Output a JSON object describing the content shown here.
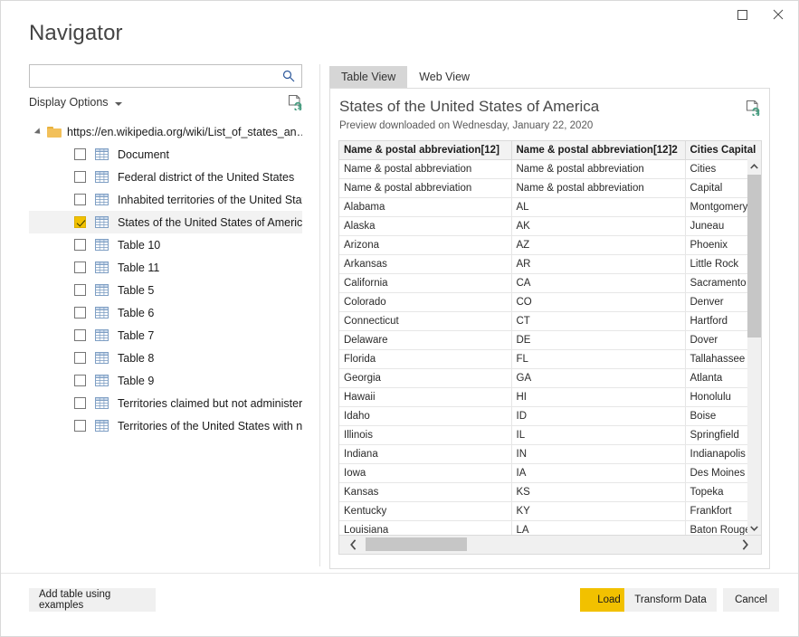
{
  "window": {
    "title": "Navigator",
    "controls": [
      {
        "name": "maximize",
        "glyph": "☐"
      },
      {
        "name": "close",
        "glyph": "✕"
      }
    ]
  },
  "left_pane": {
    "search": {
      "value": "",
      "placeholder": "",
      "icon": "search-icon"
    },
    "display_options": {
      "label": "Display Options",
      "caret": "chevron-down-icon"
    },
    "refresh_icon": "refresh-page-icon",
    "tree": {
      "root": {
        "label": "https://en.wikipedia.org/wiki/List_of_states_an…",
        "expanded": true,
        "icon": "folder-icon"
      },
      "items": [
        {
          "label": "Document",
          "checked": false,
          "selected": false
        },
        {
          "label": "Federal district of the United States",
          "checked": false,
          "selected": false
        },
        {
          "label": "Inhabited territories of the United States",
          "checked": false,
          "selected": false
        },
        {
          "label": "States of the United States of America",
          "checked": true,
          "selected": true
        },
        {
          "label": "Table 10",
          "checked": false,
          "selected": false
        },
        {
          "label": "Table 11",
          "checked": false,
          "selected": false
        },
        {
          "label": "Table 5",
          "checked": false,
          "selected": false
        },
        {
          "label": "Table 6",
          "checked": false,
          "selected": false
        },
        {
          "label": "Table 7",
          "checked": false,
          "selected": false
        },
        {
          "label": "Table 8",
          "checked": false,
          "selected": false
        },
        {
          "label": "Table 9",
          "checked": false,
          "selected": false
        },
        {
          "label": "Territories claimed but not administered b…",
          "checked": false,
          "selected": false
        },
        {
          "label": "Territories of the United States with no in…",
          "checked": false,
          "selected": false
        }
      ]
    }
  },
  "right_pane": {
    "tabs": [
      {
        "label": "Table View",
        "active": true
      },
      {
        "label": "Web View",
        "active": false
      }
    ],
    "preview": {
      "title": "States of the United States of America",
      "subtitle": "Preview downloaded on Wednesday, January 22, 2020",
      "refresh_icon": "refresh-page-icon"
    },
    "grid": {
      "columns": [
        "Name & postal abbreviation[12]",
        "Name & postal abbreviation[12]2",
        "Cities Capital"
      ],
      "rows": [
        [
          "Name & postal abbreviation",
          "Name & postal abbreviation",
          "Cities"
        ],
        [
          "Name & postal abbreviation",
          "Name & postal abbreviation",
          "Capital"
        ],
        [
          "Alabama",
          "AL",
          "Montgomery"
        ],
        [
          "Alaska",
          "AK",
          "Juneau"
        ],
        [
          "Arizona",
          "AZ",
          "Phoenix"
        ],
        [
          "Arkansas",
          "AR",
          "Little Rock"
        ],
        [
          "California",
          "CA",
          "Sacramento"
        ],
        [
          "Colorado",
          "CO",
          "Denver"
        ],
        [
          "Connecticut",
          "CT",
          "Hartford"
        ],
        [
          "Delaware",
          "DE",
          "Dover"
        ],
        [
          "Florida",
          "FL",
          "Tallahassee"
        ],
        [
          "Georgia",
          "GA",
          "Atlanta"
        ],
        [
          "Hawaii",
          "HI",
          "Honolulu"
        ],
        [
          "Idaho",
          "ID",
          "Boise"
        ],
        [
          "Illinois",
          "IL",
          "Springfield"
        ],
        [
          "Indiana",
          "IN",
          "Indianapolis"
        ],
        [
          "Iowa",
          "IA",
          "Des Moines"
        ],
        [
          "Kansas",
          "KS",
          "Topeka"
        ],
        [
          "Kentucky",
          "KY",
          "Frankfort"
        ],
        [
          "Louisiana",
          "LA",
          "Baton Rouge"
        ]
      ]
    },
    "scrollbars": {
      "vertical": {
        "up": "▲",
        "down": "▼"
      },
      "horizontal": {
        "left": "‹",
        "right": "›"
      }
    }
  },
  "footer": {
    "add_table_label": "Add table using examples",
    "load_label": "Load",
    "transform_label": "Transform Data",
    "cancel_label": "Cancel"
  },
  "colors": {
    "accent_yellow": "#f2c100",
    "tab_active_bg": "#d6d6d6",
    "selection_bg": "#f2f2f2",
    "header_bg": "#f2f2f2",
    "scroll_thumb": "#c6c6c6"
  }
}
